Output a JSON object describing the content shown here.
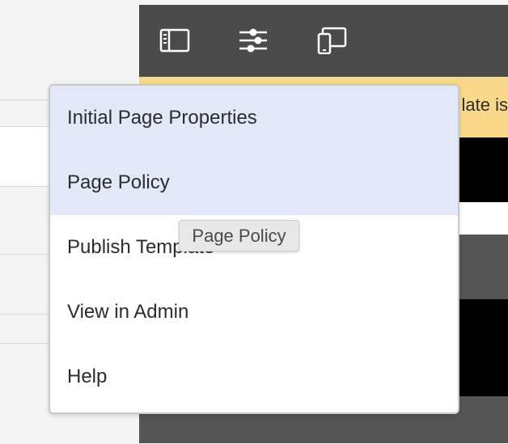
{
  "toolbar": {
    "buttons": [
      {
        "icon": "side-panel-icon"
      },
      {
        "icon": "properties-sliders-icon"
      },
      {
        "icon": "device-emulator-icon"
      }
    ]
  },
  "notice": {
    "text": "late is"
  },
  "menu": {
    "items": [
      {
        "label": "Initial Page Properties",
        "highlighted": true
      },
      {
        "label": "Page Policy",
        "highlighted": true
      },
      {
        "label": "Publish Template",
        "highlighted": false
      },
      {
        "label": "View in Admin",
        "highlighted": false
      },
      {
        "label": "Help",
        "highlighted": false
      }
    ]
  },
  "tooltip": {
    "text": "Page Policy"
  },
  "colors": {
    "toolbar_bg": "#4b4b4b",
    "notice_bg": "#fad88a",
    "menu_highlight": "#e1e8f7",
    "icon": "#ffffff"
  }
}
